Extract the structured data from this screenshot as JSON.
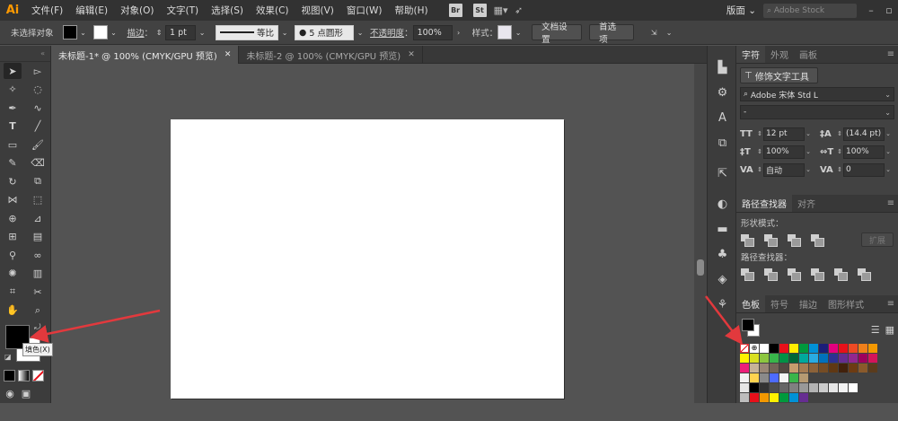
{
  "app": {
    "logo": "Ai"
  },
  "menu": [
    "文件(F)",
    "编辑(E)",
    "对象(O)",
    "文字(T)",
    "选择(S)",
    "效果(C)",
    "视图(V)",
    "窗口(W)",
    "帮助(H)"
  ],
  "app_buttons": [
    "Br",
    "St"
  ],
  "workspace": "版面",
  "search_placeholder": "Adobe Stock",
  "control": {
    "no_selection": "未选择对象",
    "stroke_label": "描边",
    "stroke_value": "1 pt",
    "profile_label": "等比",
    "brush_value": "5 点圆形",
    "opacity_label": "不透明度",
    "opacity_value": "100%",
    "style_label": "样式",
    "doc_settings": "文档设置",
    "preferences": "首选项"
  },
  "doc_tabs": [
    {
      "label": "未标题-1* @ 100% (CMYK/GPU 预览)",
      "active": true
    },
    {
      "label": "未标题-2 @ 100% (CMYK/GPU 预览)",
      "active": false
    }
  ],
  "tooltip": "填色(X)",
  "character_panel": {
    "tabs": [
      "字符",
      "外观",
      "画板"
    ],
    "touch_type": "修饰文字工具",
    "font_family": "Adobe 宋体 Std L",
    "font_style": "-",
    "size": "12 pt",
    "leading": "(14.4 pt)",
    "vscale": "100%",
    "hscale": "100%",
    "kerning": "自动",
    "tracking": "0"
  },
  "pathfinder_panel": {
    "tabs": [
      "路径查找器",
      "对齐"
    ],
    "shape_modes": "形状模式：",
    "pathfinders": "路径查找器：",
    "expand": "扩展"
  },
  "swatches_panel": {
    "tabs": [
      "色板",
      "符号",
      "描边",
      "图形样式"
    ]
  },
  "swatch_colors": [
    "none",
    "reg",
    "#ffffff",
    "#000000",
    "#e8101a",
    "#ffed00",
    "#009a3d",
    "#0091d6",
    "#1b1e78",
    "#e4007f",
    "#e8101a",
    "#ee4a24",
    "#f07f1a",
    "#f39800",
    "#fff100",
    "#d9e021",
    "#8cc63f",
    "#39b54a",
    "#009245",
    "#006837",
    "#00a99d",
    "#29abe2",
    "#0071bc",
    "#2e3192",
    "#662d91",
    "#93278f",
    "#9e005d",
    "#d4145a",
    "#ed1e79",
    "#c7b299",
    "#998675",
    "#736357",
    "#534741",
    "#c69c6d",
    "#a67c52",
    "#8c6239",
    "#754c24",
    "#603813",
    "#42210b",
    "#6d3b12",
    "#8a5a2b",
    "#5a3b1c",
    "#f2f2f2",
    "#ffd34f",
    "#8a8a8a",
    "#4d6bff",
    "#f4f4f4",
    "#3ab54a",
    "#b69a72",
    "#424242",
    "#424242",
    "#424242",
    "#424242",
    "#424242",
    "#424242",
    "#424242",
    "#e6e6e6",
    "#000000",
    "#333333",
    "#4d4d4d",
    "#666666",
    "#808080",
    "#999999",
    "#b3b3b3",
    "#cccccc",
    "#e6e6e6",
    "#f2f2f2",
    "#ffffff",
    "#424242",
    "#424242",
    "#bdbdbd",
    "#e8101a",
    "#f39800",
    "#fff100",
    "#009a3d",
    "#0091d6",
    "#662d91",
    "#424242",
    "#424242",
    "#424242",
    "#424242",
    "#424242",
    "#424242",
    "#424242"
  ],
  "colors": {
    "accent_arrow": "#e2393d",
    "ui_dark": "#323232",
    "canvas_bg": "#535353"
  }
}
